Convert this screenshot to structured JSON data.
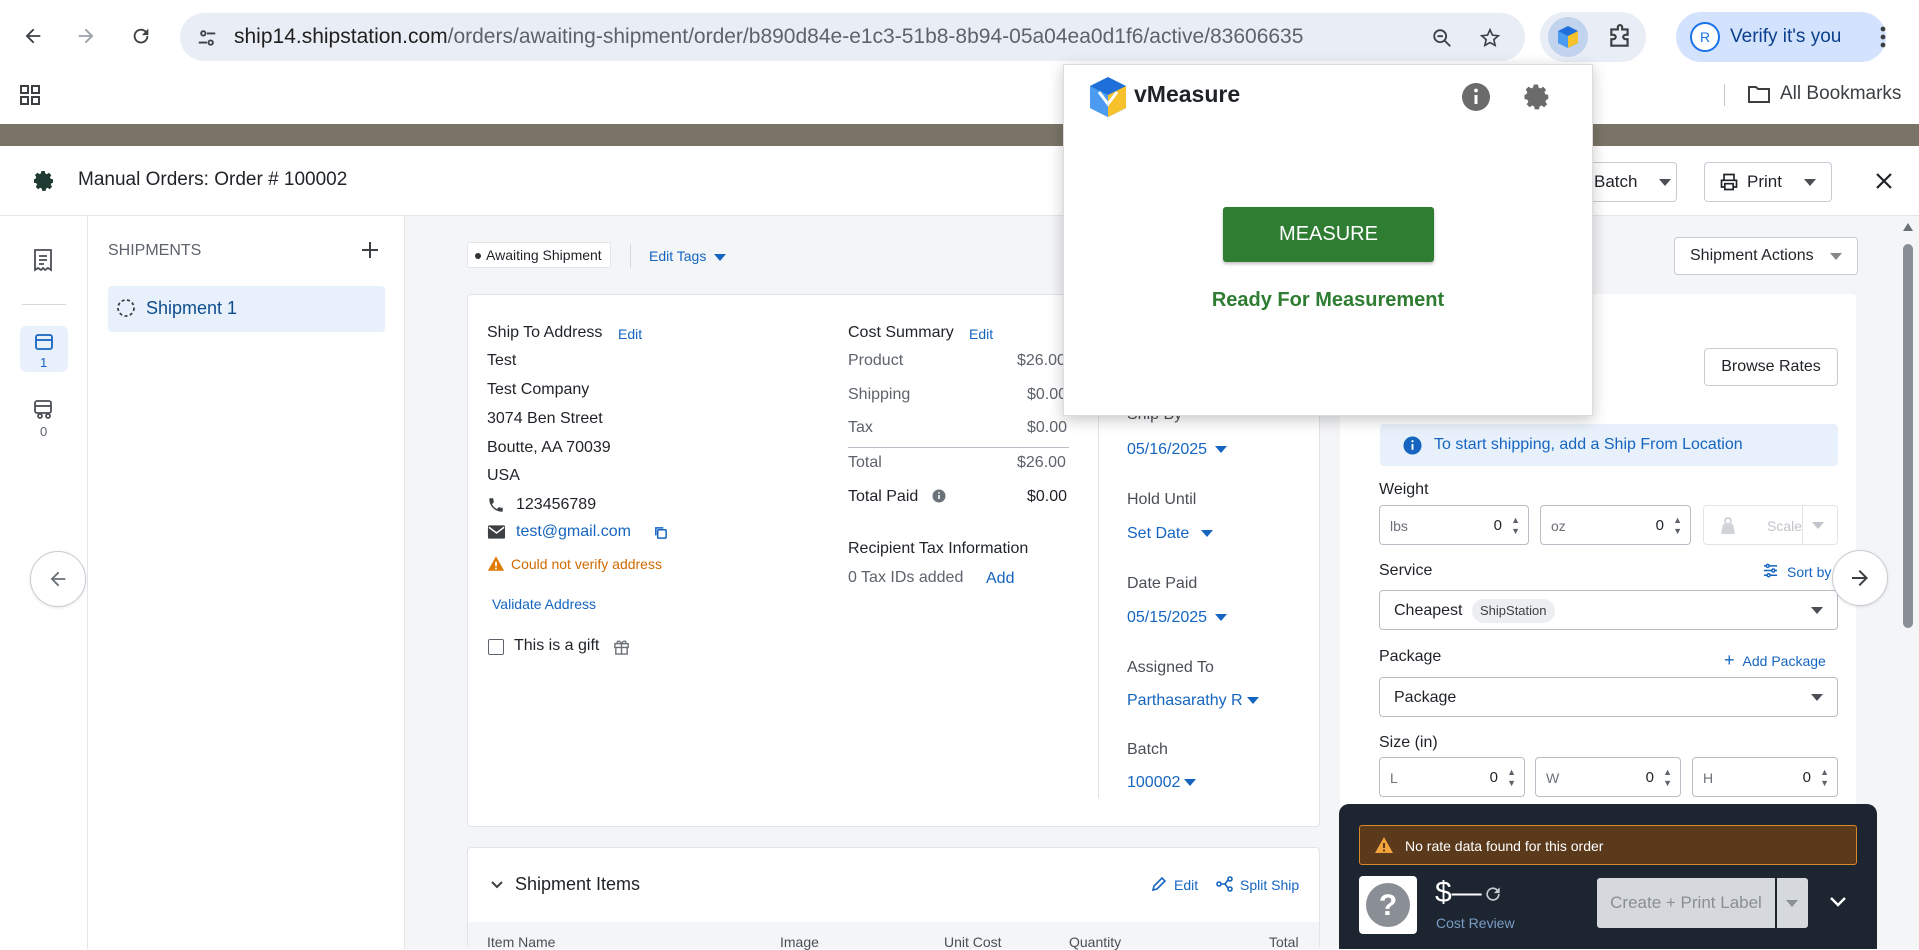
{
  "browser": {
    "url_host": "ship14.shipstation.com",
    "url_path": "/orders/awaiting-shipment/order/b890d84e-e1c3-51b8-8b94-05a04ea0d1f6/active/83606635",
    "verify_label": "Verify it's you",
    "avatar_letter": "R",
    "all_bookmarks": "All Bookmarks"
  },
  "header": {
    "title": "Manual Orders:  Order # 100002",
    "batch_label": "Batch",
    "print_label": "Print"
  },
  "left_rail": {
    "shipments_count": "1",
    "other_count": "0"
  },
  "shipments_panel": {
    "heading": "SHIPMENTS",
    "items": [
      {
        "label": "Shipment 1"
      }
    ]
  },
  "order": {
    "status_tag": "Awaiting Shipment",
    "edit_tags": "Edit Tags",
    "shipment_actions": "Shipment Actions",
    "ship_to": {
      "heading": "Ship To Address",
      "edit": "Edit",
      "name": "Test",
      "company": "Test Company",
      "street": "3074 Ben Street",
      "city_line": "Boutte, AA 70039",
      "country": "USA",
      "phone": "123456789",
      "email": "test@gmail.com",
      "warning": "Could not verify address",
      "validate": "Validate Address",
      "gift_label": "This is a gift"
    },
    "cost_summary": {
      "heading": "Cost Summary",
      "edit": "Edit",
      "rows": [
        {
          "label": "Product",
          "value": "$26.00"
        },
        {
          "label": "Shipping",
          "value": "$0.00"
        },
        {
          "label": "Tax",
          "value": "$0.00"
        },
        {
          "label": "Total",
          "value": "$26.00"
        },
        {
          "label": "Total Paid",
          "value": "$0.00"
        }
      ],
      "recipient_tax_heading": "Recipient Tax Information",
      "tax_ids": "0 Tax IDs added",
      "add": "Add"
    },
    "dates": {
      "ship_by_label": "Ship By",
      "ship_by": "05/16/2025",
      "hold_until_label": "Hold Until",
      "hold_until": "Set Date",
      "date_paid_label": "Date Paid",
      "date_paid": "05/15/2025",
      "assigned_to_label": "Assigned To",
      "assigned_to": "Parthasarathy R",
      "batch_label": "Batch",
      "batch": "100002"
    },
    "items": {
      "heading": "Shipment Items",
      "edit": "Edit",
      "split": "Split Ship",
      "columns": [
        "Item Name",
        "Image",
        "Unit Cost",
        "Quantity",
        "Total"
      ]
    }
  },
  "shipping": {
    "browse_rates": "Browse Rates",
    "info": "To start shipping, add a Ship From Location",
    "weight_label": "Weight",
    "lbs_unit": "lbs",
    "lbs_value": "0",
    "oz_unit": "oz",
    "oz_value": "0",
    "scale_label": "Scale",
    "service_label": "Service",
    "sort_by": "Sort by",
    "service_value": "Cheapest",
    "service_tag": "ShipStation",
    "package_label": "Package",
    "add_package": "Add Package",
    "package_value": "Package",
    "size_label": "Size (in)",
    "l_unit": "L",
    "l_value": "0",
    "w_unit": "W",
    "w_value": "0",
    "h_unit": "H",
    "h_value": "0"
  },
  "rate_bar": {
    "warning": "No rate data found for this order",
    "price": "$—",
    "cost_review": "Cost Review",
    "create_label": "Create + Print Label"
  },
  "vmeasure": {
    "brand": "vMeasure",
    "measure_button": "MEASURE",
    "status": "Ready For Measurement",
    "status_color": "#2e7d32",
    "button_color": "#2e7d32"
  }
}
